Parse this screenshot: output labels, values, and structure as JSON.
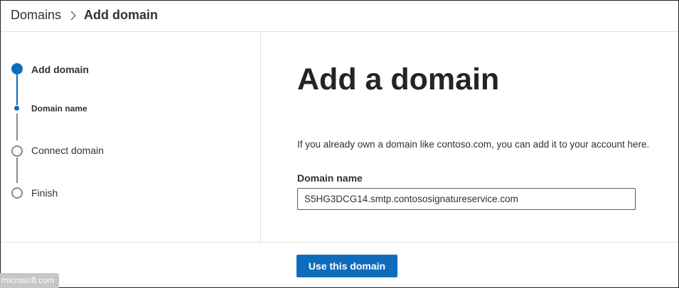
{
  "breadcrumb": {
    "root": "Domains",
    "current": "Add domain"
  },
  "stepper": {
    "steps": [
      {
        "label": "Add domain",
        "state": "current"
      },
      {
        "label": "Domain name",
        "state": "current-substep"
      },
      {
        "label": "Connect domain",
        "state": "pending"
      },
      {
        "label": "Finish",
        "state": "pending"
      }
    ]
  },
  "main": {
    "title": "Add a domain",
    "description": "If you already own a domain like contoso.com, you can add it to your account here.",
    "field_label": "Domain name",
    "field_value": "S5HG3DCG14.smtp.contososignatureservice.com"
  },
  "footer": {
    "primary_button": "Use this domain"
  },
  "watermark": "microsoft.com",
  "colors": {
    "accent": "#0f6cbd",
    "text": "#323130",
    "pending": "#8a8886"
  }
}
